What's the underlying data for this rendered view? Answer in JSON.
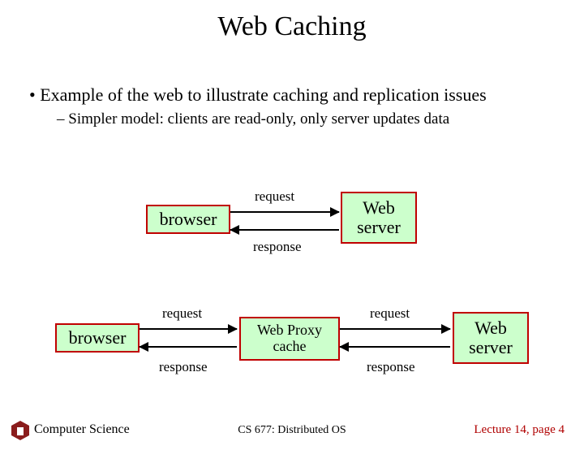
{
  "title": "Web Caching",
  "bullets": {
    "main": "Example of the web to illustrate caching and replication issues",
    "sub": "Simpler model: clients are read-only, only server updates data"
  },
  "diagram": {
    "top": {
      "browser": "browser",
      "server_line1": "Web",
      "server_line2": "server",
      "request": "request",
      "response": "response"
    },
    "bottom": {
      "browser": "browser",
      "proxy_line1": "Web Proxy",
      "proxy_line2": "cache",
      "server_line1": "Web",
      "server_line2": "server",
      "request_left": "request",
      "response_left": "response",
      "request_right": "request",
      "response_right": "response"
    }
  },
  "footer": {
    "left": "Computer Science",
    "center": "CS 677: Distributed OS",
    "right": "Lecture 14, page 4"
  }
}
